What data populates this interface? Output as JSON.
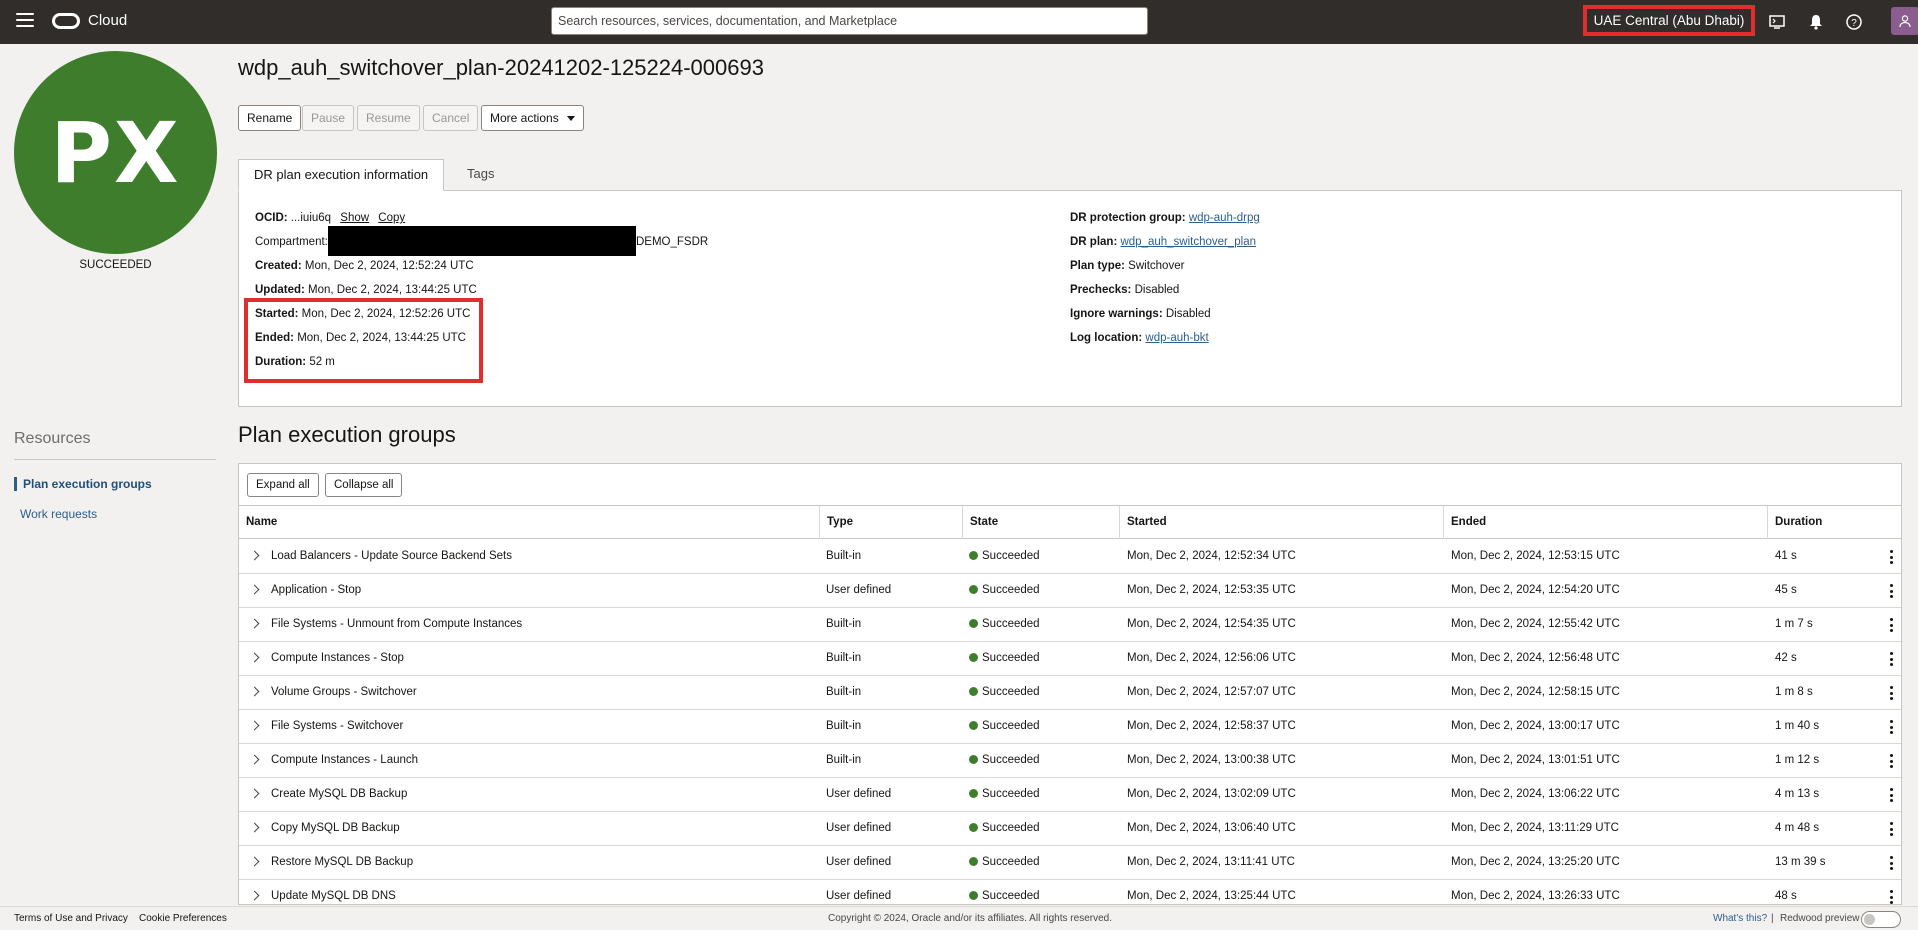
{
  "topbar": {
    "brand": "Cloud",
    "search_placeholder": "Search resources, services, documentation, and Marketplace",
    "region": "UAE Central (Abu Dhabi)",
    "icons": [
      "menu-icon",
      "cloud-shell-icon",
      "bell-icon",
      "help-icon",
      "user-icon"
    ],
    "highlight_color": "#e02d2d"
  },
  "execution": {
    "avatar_initials": "PX",
    "avatar_color": "#3e7d2c",
    "status": "SUCCEEDED",
    "title": "wdp_auh_switchover_plan-20241202-125224-000693"
  },
  "actions": {
    "rename": "Rename",
    "pause": "Pause",
    "resume": "Resume",
    "cancel": "Cancel",
    "more": "More actions"
  },
  "tabs": {
    "info": "DR plan execution information",
    "tags": "Tags"
  },
  "info": {
    "ocid_label": "OCID:",
    "ocid_value": "...iuiu6q",
    "show": "Show",
    "copy": "Copy",
    "compartment_label": "Compartment:",
    "compartment_value": "DEMO_FSDR",
    "created_label": "Created:",
    "created_value": "Mon, Dec 2, 2024, 12:52:24 UTC",
    "updated_label": "Updated:",
    "updated_value": "Mon, Dec 2, 2024, 13:44:25 UTC",
    "started_label": "Started:",
    "started_value": "Mon, Dec 2, 2024, 12:52:26 UTC",
    "ended_label": "Ended:",
    "ended_value": "Mon, Dec 2, 2024, 13:44:25 UTC",
    "duration_label": "Duration:",
    "duration_value": "52 m",
    "protection_group_label": "DR protection group:",
    "protection_group_value": "wdp-auh-drpg",
    "dr_plan_label": "DR plan:",
    "dr_plan_value": "wdp_auh_switchover_plan",
    "plan_type_label": "Plan type:",
    "plan_type_value": "Switchover",
    "prechecks_label": "Prechecks:",
    "prechecks_value": "Disabled",
    "ignore_warnings_label": "Ignore warnings:",
    "ignore_warnings_value": "Disabled",
    "log_location_label": "Log location:",
    "log_location_value": "wdp-auh-bkt"
  },
  "resources": {
    "title": "Resources",
    "items": [
      "Plan execution groups",
      "Work requests"
    ]
  },
  "groups": {
    "title": "Plan execution groups",
    "expand_all": "Expand all",
    "collapse_all": "Collapse all",
    "columns": [
      "Name",
      "Type",
      "State",
      "Started",
      "Ended",
      "Duration"
    ],
    "rows": [
      {
        "name": "Load Balancers - Update Source Backend Sets",
        "type": "Built-in",
        "state": "Succeeded",
        "started": "Mon, Dec 2, 2024, 12:52:34 UTC",
        "ended": "Mon, Dec 2, 2024, 12:53:15 UTC",
        "duration": "41 s"
      },
      {
        "name": "Application - Stop",
        "type": "User defined",
        "state": "Succeeded",
        "started": "Mon, Dec 2, 2024, 12:53:35 UTC",
        "ended": "Mon, Dec 2, 2024, 12:54:20 UTC",
        "duration": "45 s"
      },
      {
        "name": "File Systems - Unmount from Compute Instances",
        "type": "Built-in",
        "state": "Succeeded",
        "started": "Mon, Dec 2, 2024, 12:54:35 UTC",
        "ended": "Mon, Dec 2, 2024, 12:55:42 UTC",
        "duration": "1 m 7 s"
      },
      {
        "name": "Compute Instances - Stop",
        "type": "Built-in",
        "state": "Succeeded",
        "started": "Mon, Dec 2, 2024, 12:56:06 UTC",
        "ended": "Mon, Dec 2, 2024, 12:56:48 UTC",
        "duration": "42 s"
      },
      {
        "name": "Volume Groups - Switchover",
        "type": "Built-in",
        "state": "Succeeded",
        "started": "Mon, Dec 2, 2024, 12:57:07 UTC",
        "ended": "Mon, Dec 2, 2024, 12:58:15 UTC",
        "duration": "1 m 8 s"
      },
      {
        "name": "File Systems - Switchover",
        "type": "Built-in",
        "state": "Succeeded",
        "started": "Mon, Dec 2, 2024, 12:58:37 UTC",
        "ended": "Mon, Dec 2, 2024, 13:00:17 UTC",
        "duration": "1 m 40 s"
      },
      {
        "name": "Compute Instances - Launch",
        "type": "Built-in",
        "state": "Succeeded",
        "started": "Mon, Dec 2, 2024, 13:00:38 UTC",
        "ended": "Mon, Dec 2, 2024, 13:01:51 UTC",
        "duration": "1 m 12 s"
      },
      {
        "name": "Create MySQL DB Backup",
        "type": "User defined",
        "state": "Succeeded",
        "started": "Mon, Dec 2, 2024, 13:02:09 UTC",
        "ended": "Mon, Dec 2, 2024, 13:06:22 UTC",
        "duration": "4 m 13 s"
      },
      {
        "name": "Copy MySQL DB Backup",
        "type": "User defined",
        "state": "Succeeded",
        "started": "Mon, Dec 2, 2024, 13:06:40 UTC",
        "ended": "Mon, Dec 2, 2024, 13:11:29 UTC",
        "duration": "4 m 48 s"
      },
      {
        "name": "Restore MySQL DB Backup",
        "type": "User defined",
        "state": "Succeeded",
        "started": "Mon, Dec 2, 2024, 13:11:41 UTC",
        "ended": "Mon, Dec 2, 2024, 13:25:20 UTC",
        "duration": "13 m 39 s"
      },
      {
        "name": "Update MySQL DB DNS",
        "type": "User defined",
        "state": "Succeeded",
        "started": "Mon, Dec 2, 2024, 13:25:44 UTC",
        "ended": "Mon, Dec 2, 2024, 13:26:33 UTC",
        "duration": "48 s"
      }
    ]
  },
  "footer": {
    "terms": "Terms of Use and Privacy",
    "cookies": "Cookie Preferences",
    "copyright": "Copyright © 2024, Oracle and/or its affiliates. All rights reserved.",
    "whats_this": "What's this?",
    "redwood": "Redwood preview"
  }
}
